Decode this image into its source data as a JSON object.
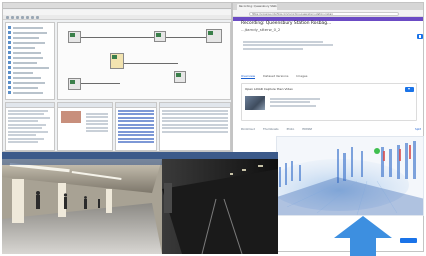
{
  "browser": {
    "tab_title": "Recording: Queensbury Station Rosbag...",
    "url": "https://universe.roboflow.com/recording-queensbury-station-rosbag",
    "page_title": "Recording: Queensbury Station Rosbag...",
    "page_subtitle": "...jtamdy_stterw_0_2",
    "subtabs": [
      "Overview",
      "Dataset Versions",
      "Images"
    ],
    "card_title": "Open LiDAR Capture then Video",
    "viewer_toolbar": [
      "Pointcloud",
      "Thumbnails",
      "Photo",
      "HDMAP",
      "Split"
    ]
  },
  "colors": {
    "accent": "#1a73e8",
    "arrow": "#3d8fe0",
    "ide_selection": "#3d6fc6"
  },
  "icons": {
    "download": "download-icon",
    "dropdown": "chevron-down-icon",
    "arrow": "up-arrow-icon"
  }
}
